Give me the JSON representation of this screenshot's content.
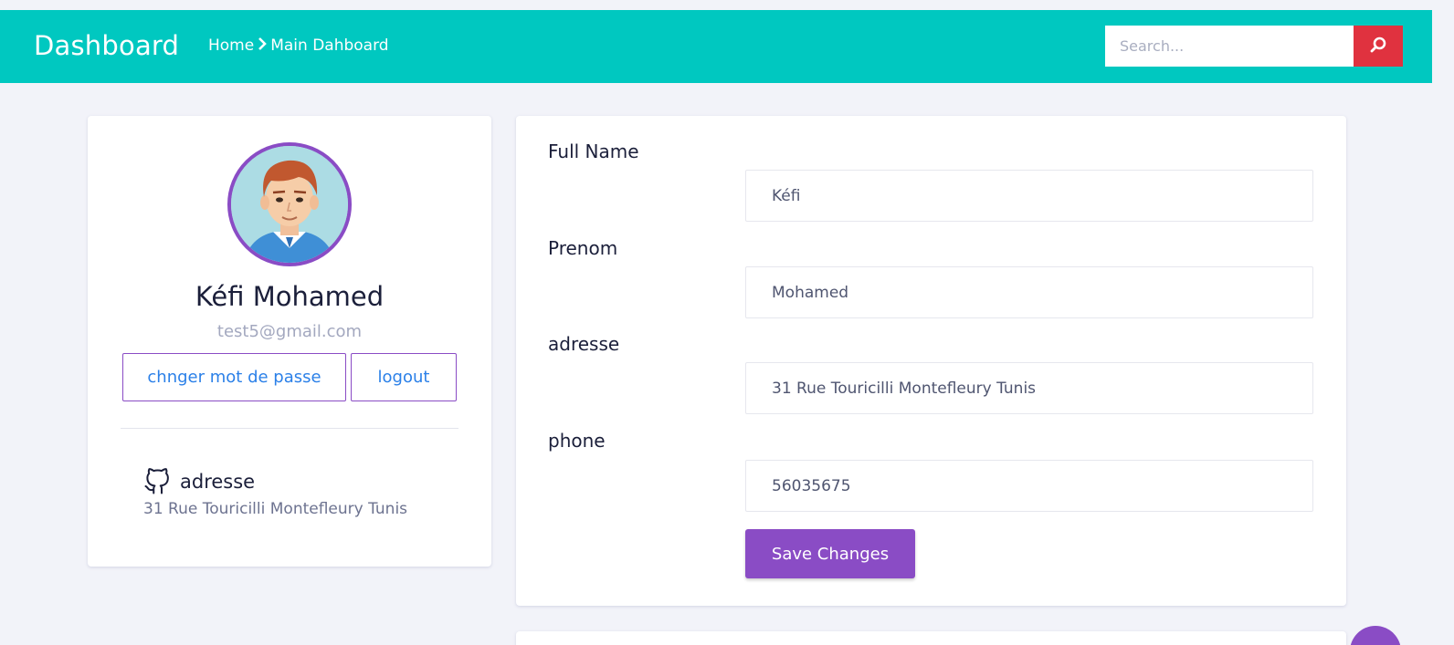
{
  "header": {
    "brand": "Dashboard",
    "breadcrumb": {
      "home": "Home",
      "separator_icon": "chevron-right-icon",
      "current": "Main Dahboard"
    },
    "search": {
      "placeholder": "Search...",
      "value": "",
      "button_icon": "search-icon"
    }
  },
  "profile": {
    "avatar_icon": "user-avatar-icon",
    "name": "Kéfi Mohamed",
    "email": "test5@gmail.com",
    "change_password_label": "chnger mot de passe",
    "logout_label": "logout",
    "info": {
      "icon": "github-icon",
      "label": "adresse",
      "value": "31 Rue Touricilli Montefleury Tunis"
    }
  },
  "form": {
    "fields": [
      {
        "label": "Full Name",
        "value": "Kéfi"
      },
      {
        "label": "Prenom",
        "value": "Mohamed"
      },
      {
        "label": "adresse",
        "value": "31 Rue Touricilli Montefleury Tunis"
      },
      {
        "label": "phone",
        "value": "56035675"
      }
    ],
    "save_label": "Save Changes"
  },
  "colors": {
    "header_bg": "#00c8c0",
    "accent": "#8a4cc5",
    "search_button": "#e0323f",
    "link": "#2b80e8",
    "page_bg": "#f2f3f9"
  }
}
